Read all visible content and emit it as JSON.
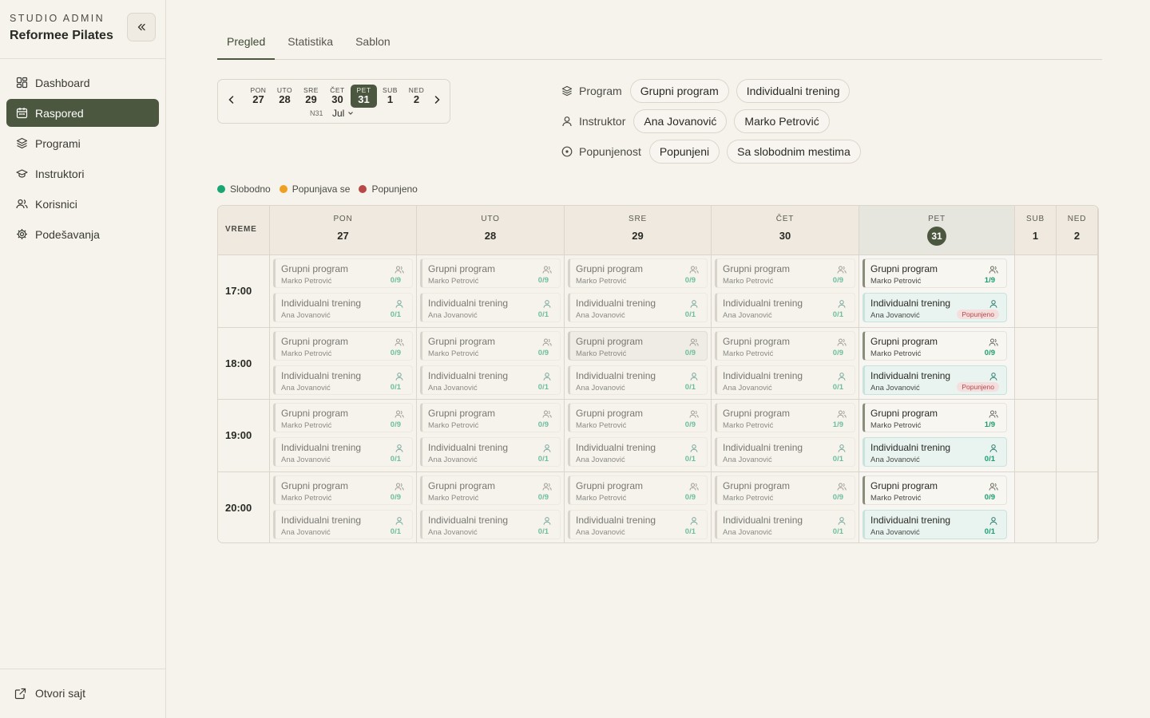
{
  "sidebar": {
    "subtitle": "STUDIO ADMIN",
    "title": "Reformee Pilates",
    "items": [
      {
        "label": "Dashboard",
        "icon": "dashboard-icon"
      },
      {
        "label": "Raspored",
        "icon": "calendar-icon"
      },
      {
        "label": "Programi",
        "icon": "layers-icon"
      },
      {
        "label": "Instruktori",
        "icon": "graduation-cap-icon"
      },
      {
        "label": "Korisnici",
        "icon": "users-icon"
      },
      {
        "label": "Podešavanja",
        "icon": "gear-icon"
      }
    ],
    "active_item": "Raspored",
    "footer_link": "Otvori sajt"
  },
  "tabs": [
    "Pregled",
    "Statistika",
    "Sablon"
  ],
  "active_tab": "Pregled",
  "datepicker": {
    "days": [
      {
        "name": "PON",
        "num": "27"
      },
      {
        "name": "UTO",
        "num": "28"
      },
      {
        "name": "SRE",
        "num": "29"
      },
      {
        "name": "ČET",
        "num": "30"
      },
      {
        "name": "PET",
        "num": "31"
      },
      {
        "name": "SUB",
        "num": "1"
      },
      {
        "name": "NED",
        "num": "2"
      }
    ],
    "selected_day": "31",
    "week": "N31",
    "month": "Jul"
  },
  "filters": {
    "program": {
      "label": "Program",
      "options": [
        "Grupni program",
        "Individualni trening"
      ]
    },
    "instructor": {
      "label": "Instruktor",
      "options": [
        "Ana Jovanović",
        "Marko Petrović"
      ]
    },
    "occupancy": {
      "label": "Popunjenost",
      "options": [
        "Popunjeni",
        "Sa slobodnim mestima"
      ]
    }
  },
  "legend": [
    {
      "label": "Slobodno",
      "color": "#1aa672"
    },
    {
      "label": "Popunjava se",
      "color": "#f0a020"
    },
    {
      "label": "Popunjeno",
      "color": "#b84848"
    }
  ],
  "schedule": {
    "time_header": "VREME",
    "columns": [
      {
        "day": "PON",
        "num": "27",
        "today": false
      },
      {
        "day": "UTO",
        "num": "28",
        "today": false
      },
      {
        "day": "SRE",
        "num": "29",
        "today": false
      },
      {
        "day": "ČET",
        "num": "30",
        "today": false
      },
      {
        "day": "PET",
        "num": "31",
        "today": true
      },
      {
        "day": "SUB",
        "num": "1",
        "today": false
      },
      {
        "day": "NED",
        "num": "2",
        "today": false
      }
    ],
    "rows": [
      {
        "time": "17:00",
        "cells": [
          [
            {
              "title": "Grupni program",
              "instructor": "Marko Petrović",
              "count": "0/9",
              "type": "group"
            },
            {
              "title": "Individualni trening",
              "instructor": "Ana Jovanović",
              "count": "0/1",
              "type": "individual"
            }
          ],
          [
            {
              "title": "Grupni program",
              "instructor": "Marko Petrović",
              "count": "0/9",
              "type": "group"
            },
            {
              "title": "Individualni trening",
              "instructor": "Ana Jovanović",
              "count": "0/1",
              "type": "individual"
            }
          ],
          [
            {
              "title": "Grupni program",
              "instructor": "Marko Petrović",
              "count": "0/9",
              "type": "group"
            },
            {
              "title": "Individualni trening",
              "instructor": "Ana Jovanović",
              "count": "0/1",
              "type": "individual"
            }
          ],
          [
            {
              "title": "Grupni program",
              "instructor": "Marko Petrović",
              "count": "0/9",
              "type": "group"
            },
            {
              "title": "Individualni trening",
              "instructor": "Ana Jovanović",
              "count": "0/1",
              "type": "individual"
            }
          ],
          [
            {
              "title": "Grupni program",
              "instructor": "Marko Petrović",
              "count": "1/9",
              "type": "group",
              "active": true
            },
            {
              "title": "Individualni trening",
              "instructor": "Ana Jovanović",
              "badge": "Popunjeno",
              "type": "individual",
              "active": true
            }
          ],
          [],
          []
        ]
      },
      {
        "time": "18:00",
        "cells": [
          [
            {
              "title": "Grupni program",
              "instructor": "Marko Petrović",
              "count": "0/9",
              "type": "group"
            },
            {
              "title": "Individualni trening",
              "instructor": "Ana Jovanović",
              "count": "0/1",
              "type": "individual"
            }
          ],
          [
            {
              "title": "Grupni program",
              "instructor": "Marko Petrović",
              "count": "0/9",
              "type": "group"
            },
            {
              "title": "Individualni trening",
              "instructor": "Ana Jovanović",
              "count": "0/1",
              "type": "individual"
            }
          ],
          [
            {
              "title": "Grupni program",
              "instructor": "Marko Petrović",
              "count": "0/9",
              "type": "group",
              "highlight": true
            },
            {
              "title": "Individualni trening",
              "instructor": "Ana Jovanović",
              "count": "0/1",
              "type": "individual"
            }
          ],
          [
            {
              "title": "Grupni program",
              "instructor": "Marko Petrović",
              "count": "0/9",
              "type": "group"
            },
            {
              "title": "Individualni trening",
              "instructor": "Ana Jovanović",
              "count": "0/1",
              "type": "individual"
            }
          ],
          [
            {
              "title": "Grupni program",
              "instructor": "Marko Petrović",
              "count": "0/9",
              "type": "group",
              "active": true
            },
            {
              "title": "Individualni trening",
              "instructor": "Ana Jovanović",
              "badge": "Popunjeno",
              "type": "individual",
              "active": true
            }
          ],
          [],
          []
        ]
      },
      {
        "time": "19:00",
        "cells": [
          [
            {
              "title": "Grupni program",
              "instructor": "Marko Petrović",
              "count": "0/9",
              "type": "group"
            },
            {
              "title": "Individualni trening",
              "instructor": "Ana Jovanović",
              "count": "0/1",
              "type": "individual"
            }
          ],
          [
            {
              "title": "Grupni program",
              "instructor": "Marko Petrović",
              "count": "0/9",
              "type": "group"
            },
            {
              "title": "Individualni trening",
              "instructor": "Ana Jovanović",
              "count": "0/1",
              "type": "individual"
            }
          ],
          [
            {
              "title": "Grupni program",
              "instructor": "Marko Petrović",
              "count": "0/9",
              "type": "group"
            },
            {
              "title": "Individualni trening",
              "instructor": "Ana Jovanović",
              "count": "0/1",
              "type": "individual"
            }
          ],
          [
            {
              "title": "Grupni program",
              "instructor": "Marko Petrović",
              "count": "1/9",
              "type": "group"
            },
            {
              "title": "Individualni trening",
              "instructor": "Ana Jovanović",
              "count": "0/1",
              "type": "individual"
            }
          ],
          [
            {
              "title": "Grupni program",
              "instructor": "Marko Petrović",
              "count": "1/9",
              "type": "group",
              "active": true
            },
            {
              "title": "Individualni trening",
              "instructor": "Ana Jovanović",
              "count": "0/1",
              "type": "individual",
              "active": true
            }
          ],
          [],
          []
        ]
      },
      {
        "time": "20:00",
        "cells": [
          [
            {
              "title": "Grupni program",
              "instructor": "Marko Petrović",
              "count": "0/9",
              "type": "group"
            },
            {
              "title": "Individualni trening",
              "instructor": "Ana Jovanović",
              "count": "0/1",
              "type": "individual"
            }
          ],
          [
            {
              "title": "Grupni program",
              "instructor": "Marko Petrović",
              "count": "0/9",
              "type": "group"
            },
            {
              "title": "Individualni trening",
              "instructor": "Ana Jovanović",
              "count": "0/1",
              "type": "individual"
            }
          ],
          [
            {
              "title": "Grupni program",
              "instructor": "Marko Petrović",
              "count": "0/9",
              "type": "group"
            },
            {
              "title": "Individualni trening",
              "instructor": "Ana Jovanović",
              "count": "0/1",
              "type": "individual"
            }
          ],
          [
            {
              "title": "Grupni program",
              "instructor": "Marko Petrović",
              "count": "0/9",
              "type": "group"
            },
            {
              "title": "Individualni trening",
              "instructor": "Ana Jovanović",
              "count": "0/1",
              "type": "individual"
            }
          ],
          [
            {
              "title": "Grupni program",
              "instructor": "Marko Petrović",
              "count": "0/9",
              "type": "group",
              "active": true
            },
            {
              "title": "Individualni trening",
              "instructor": "Ana Jovanović",
              "count": "0/1",
              "type": "individual",
              "active": true
            }
          ],
          [],
          []
        ]
      }
    ]
  }
}
